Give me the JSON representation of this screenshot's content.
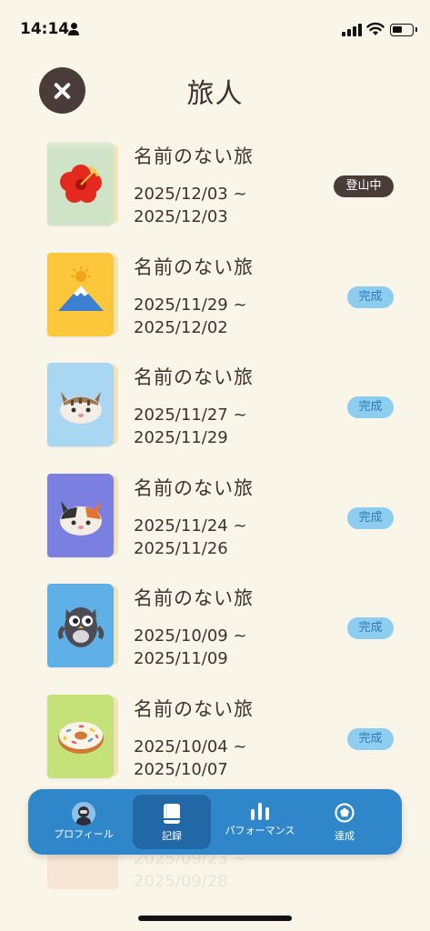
{
  "status_bar": {
    "time": "14:14"
  },
  "header": {
    "title": "旅人"
  },
  "trips": [
    {
      "title": "名前のない旅",
      "start": "2025/12/03 ~",
      "end": "2025/12/03",
      "status": "登山中",
      "cover_icon": "hibiscus-flower-icon",
      "cover_color": "#cfe3c6"
    },
    {
      "title": "名前のない旅",
      "start": "2025/11/29 ~",
      "end": "2025/12/02",
      "status": "完成",
      "cover_icon": "mount-fuji-icon",
      "cover_color": "#fcc73a"
    },
    {
      "title": "名前のない旅",
      "start": "2025/11/27 ~",
      "end": "2025/11/29",
      "status": "完成",
      "cover_icon": "tabby-cat-icon",
      "cover_color": "#a9d6f1"
    },
    {
      "title": "名前のない旅",
      "start": "2025/11/24 ~",
      "end": "2025/11/26",
      "status": "完成",
      "cover_icon": "calico-cat-icon",
      "cover_color": "#7a7fe0"
    },
    {
      "title": "名前のない旅",
      "start": "2025/10/09 ~",
      "end": "2025/11/09",
      "status": "完成",
      "cover_icon": "owl-icon",
      "cover_color": "#5fb0e6"
    },
    {
      "title": "名前のない旅",
      "start": "2025/10/04 ~",
      "end": "2025/10/07",
      "status": "完成",
      "cover_icon": "donut-icon",
      "cover_color": "#c5e17a"
    }
  ],
  "partial_trip": {
    "start": "2025/09/23 ~",
    "end": "2025/09/28"
  },
  "tab_bar": {
    "tabs": [
      {
        "label": "プロフィール",
        "icon": "avatar-icon",
        "active": false
      },
      {
        "label": "記録",
        "icon": "book-icon",
        "active": true
      },
      {
        "label": "パフォーマンス",
        "icon": "bar-chart-icon",
        "active": false
      },
      {
        "label": "達成",
        "icon": "pentagon-badge-icon",
        "active": false
      }
    ]
  },
  "colors": {
    "background": "#faf5e9",
    "dark_brown": "#4a3c39",
    "tab_bar": "#2f86c8",
    "tab_active": "#2268a6",
    "badge_done_bg": "#8ccdf0",
    "badge_done_text": "#2e79b5"
  }
}
